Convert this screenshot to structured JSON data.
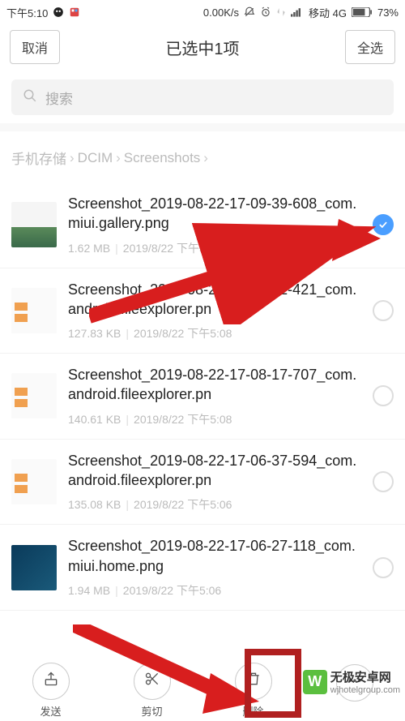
{
  "status": {
    "time": "下午5:10",
    "net_speed": "0.00K/s",
    "carrier": "移动 4G",
    "battery": "73%"
  },
  "header": {
    "cancel": "取消",
    "title": "已选中1项",
    "select_all": "全选"
  },
  "search": {
    "placeholder": "搜索"
  },
  "breadcrumb": {
    "items": [
      "手机存储",
      "DCIM",
      "Screenshots"
    ]
  },
  "files": [
    {
      "name": "Screenshot_2019-08-22-17-09-39-608_com.miui.gallery.png",
      "size": "1.62 MB",
      "date": "2019/8/22 下午5:09",
      "selected": true
    },
    {
      "name": "Screenshot_2019-08-22-17-08-22-421_com.android.fileexplorer.pn",
      "size": "127.83 KB",
      "date": "2019/8/22 下午5:08",
      "selected": false
    },
    {
      "name": "Screenshot_2019-08-22-17-08-17-707_com.android.fileexplorer.pn",
      "size": "140.61 KB",
      "date": "2019/8/22 下午5:08",
      "selected": false
    },
    {
      "name": "Screenshot_2019-08-22-17-06-37-594_com.android.fileexplorer.pn",
      "size": "135.08 KB",
      "date": "2019/8/22 下午5:06",
      "selected": false
    },
    {
      "name": "Screenshot_2019-08-22-17-06-27-118_com.miui.home.png",
      "size": "1.94 MB",
      "date": "2019/8/22 下午5:06",
      "selected": false
    }
  ],
  "bottom": {
    "send": "发送",
    "cut": "剪切",
    "delete": "删除"
  },
  "watermark": {
    "name": "无极安卓网",
    "url": "wjhotelgroup.com",
    "logo": "W"
  }
}
